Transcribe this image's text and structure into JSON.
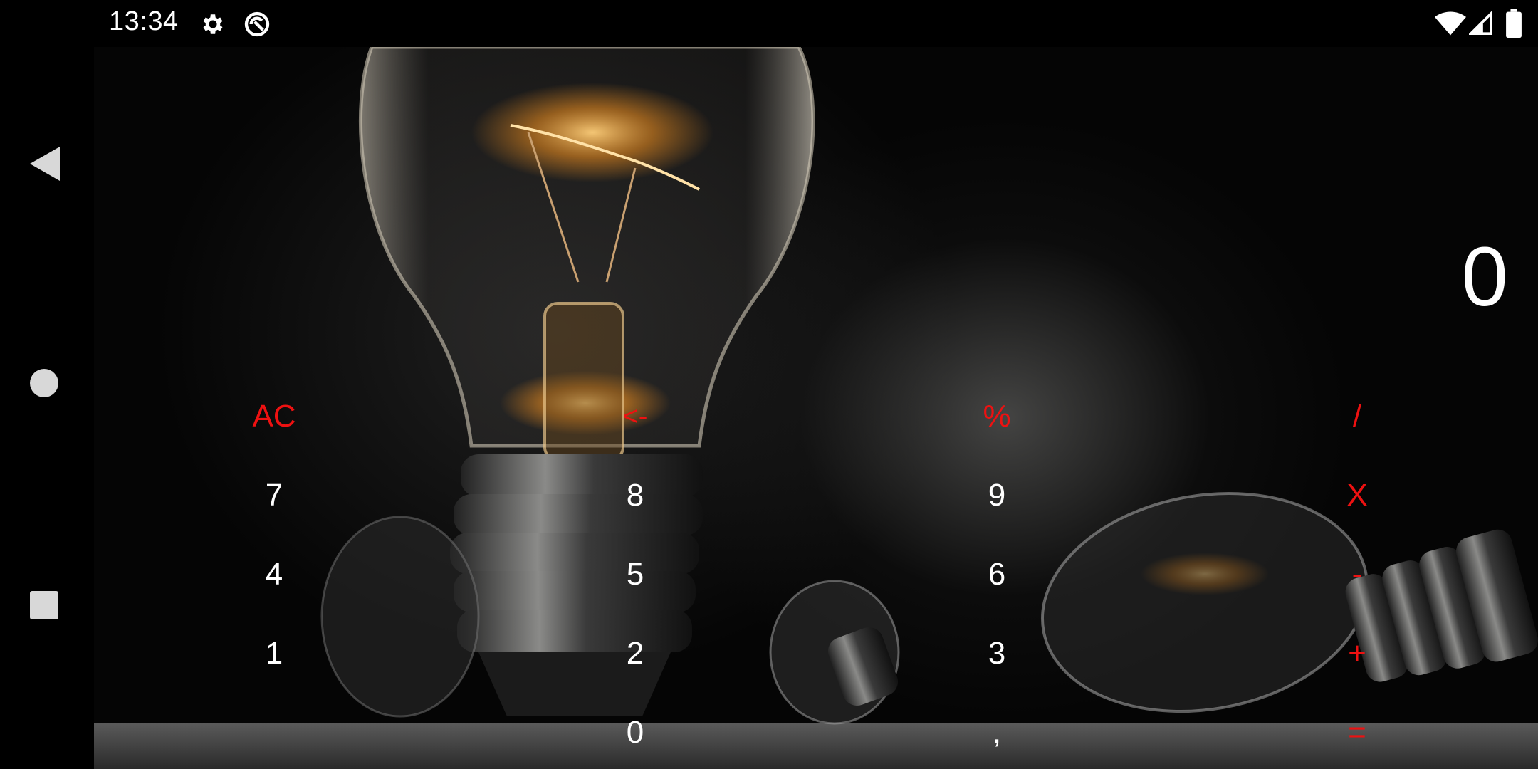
{
  "status_bar": {
    "time": "13:34",
    "icons": [
      "gear-icon",
      "sync-icon",
      "wifi-icon",
      "signal-icon",
      "battery-icon"
    ]
  },
  "navigation": {
    "back": "back-triangle-icon",
    "home": "home-circle-icon",
    "recents": "recents-square-icon"
  },
  "display": {
    "value": "0"
  },
  "keypad": {
    "ac": "AC",
    "backspace": "<-",
    "percent": "%",
    "divide": "/",
    "seven": "7",
    "eight": "8",
    "nine": "9",
    "multiply": "X",
    "four": "4",
    "five": "5",
    "six": "6",
    "minus": "-",
    "one": "1",
    "two": "2",
    "three": "3",
    "plus": "+",
    "zero": "0",
    "comma": ",",
    "equals": "="
  },
  "colors": {
    "operator": "#ee1111",
    "digit": "#ffffff",
    "background": "#000000"
  }
}
